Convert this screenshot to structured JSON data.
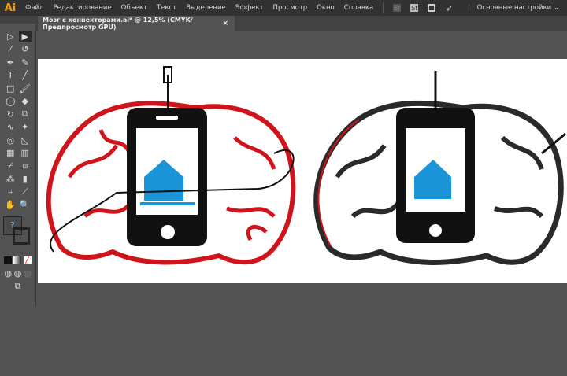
{
  "app": {
    "logo": "Ai"
  },
  "menu": [
    "Файл",
    "Редактирование",
    "Объект",
    "Текст",
    "Выделение",
    "Эффект",
    "Просмотр",
    "Окно",
    "Справка"
  ],
  "toolbar_icons": {
    "bridge": "Br",
    "stock": "St"
  },
  "workspace": "Основные настройки ⌄",
  "document_tab": {
    "title": "Мозг с коннекторами.ai* @ 12,5% (CMYK/Предпросмотр GPU)",
    "close": "×"
  },
  "fill_stroke_label": "?",
  "colors": {
    "brain": "#d0141b",
    "phone": "#111111",
    "house": "#1a96d8"
  }
}
